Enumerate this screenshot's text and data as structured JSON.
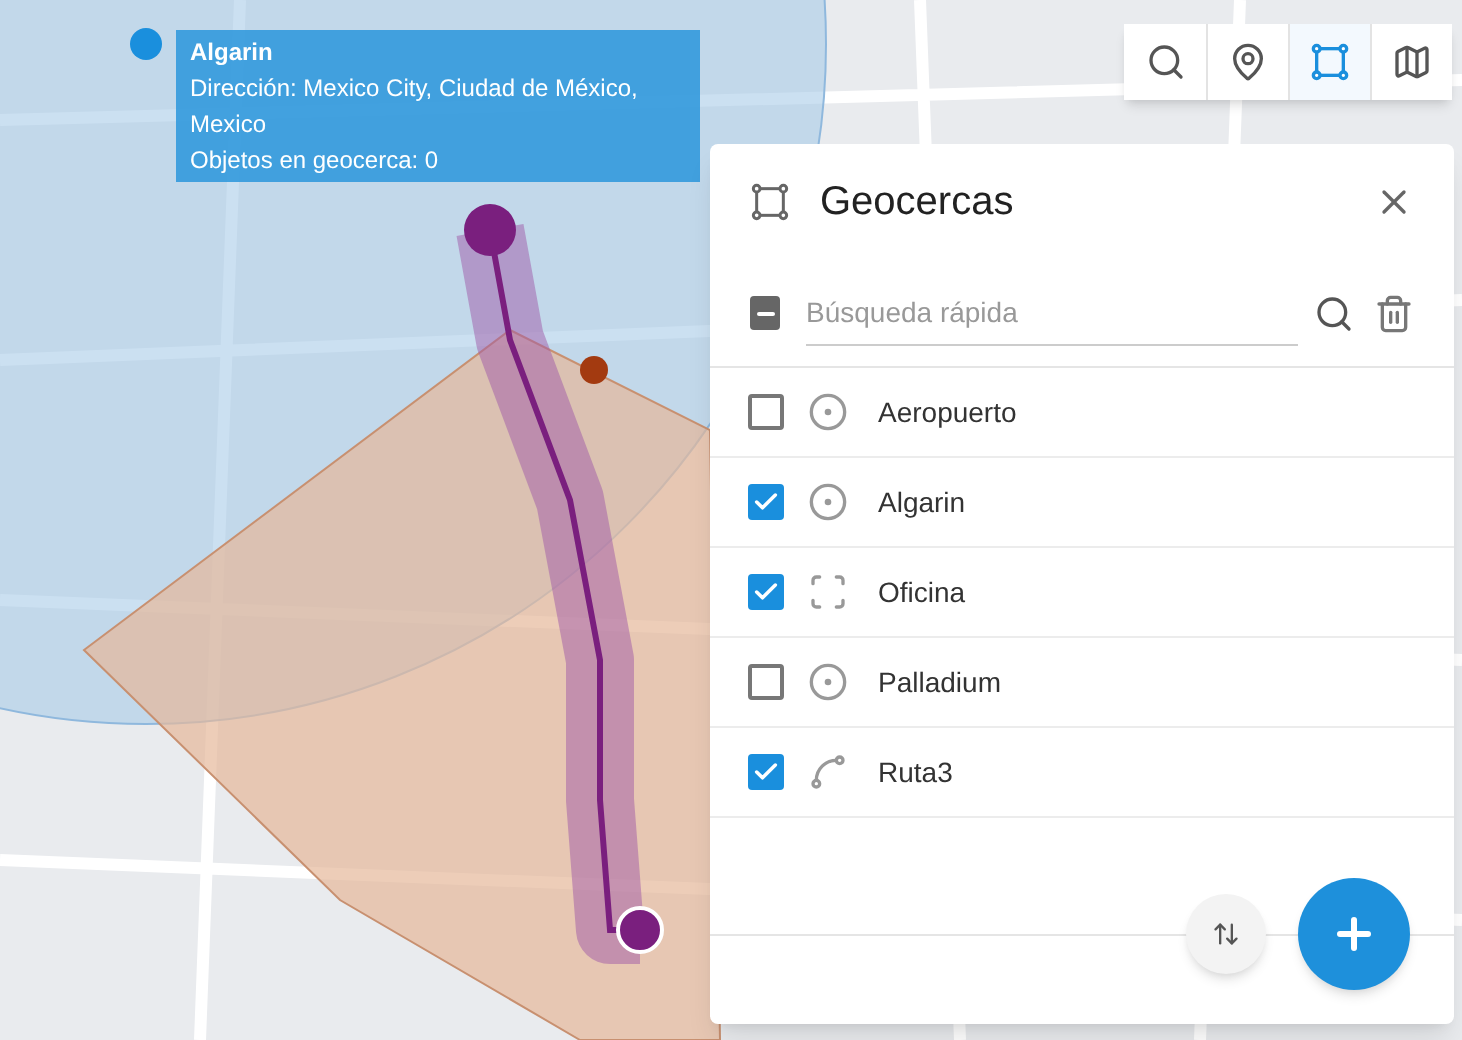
{
  "toolbar": [
    {
      "kind": "search",
      "selected": false
    },
    {
      "kind": "marker",
      "selected": false
    },
    {
      "kind": "geofence",
      "selected": true
    },
    {
      "kind": "map",
      "selected": false
    }
  ],
  "tooltip": {
    "title": "Algarin",
    "lines": [
      "Dirección: Mexico City, Ciudad de México, Mexico",
      "Objetos en geocerca: 0"
    ]
  },
  "panel": {
    "title": "Geocercas",
    "select_all": {
      "indeterminate": true
    },
    "search": {
      "placeholder": "Búsqueda rápida"
    },
    "items": [
      {
        "name": "Aeropuerto",
        "kind": "circle",
        "checked": false
      },
      {
        "name": "Algarin",
        "kind": "circle",
        "checked": true
      },
      {
        "name": "Oficina",
        "kind": "polygon",
        "checked": true
      },
      {
        "name": "Palladium",
        "kind": "circle",
        "checked": false
      },
      {
        "name": "Ruta3",
        "kind": "route",
        "checked": true
      }
    ]
  }
}
